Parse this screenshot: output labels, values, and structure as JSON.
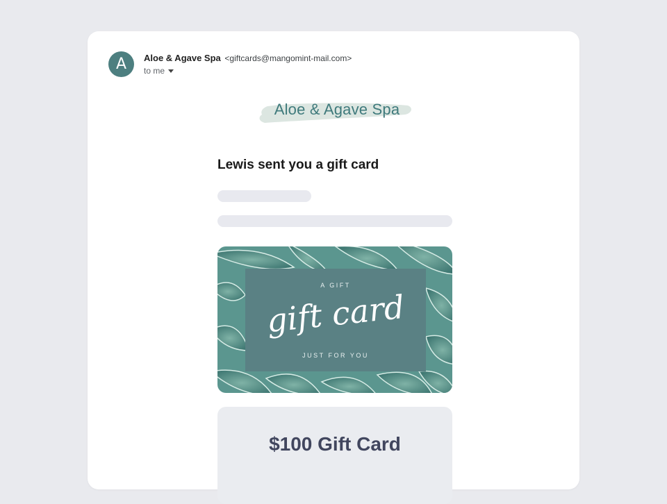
{
  "email": {
    "avatar_letter": "A",
    "sender_name": "Aloe & Agave Spa",
    "sender_email": "<giftcards@mangomint-mail.com>",
    "recipient": "to me"
  },
  "logo": {
    "text": "Aloe & Agave Spa",
    "brush_color": "#dce6e1",
    "text_color": "#3f7a7c"
  },
  "message": {
    "headline": "Lewis sent you a gift card"
  },
  "gift_card": {
    "top_text": "A GIFT",
    "script_text": "gift card",
    "bottom_text": "JUST FOR YOU",
    "panel_color": "#5a8184"
  },
  "amount": {
    "label": "$100 Gift Card"
  },
  "colors": {
    "background": "#e9eaee",
    "card": "#ffffff",
    "avatar": "#4d7f80",
    "skeleton": "#e8e9ef"
  }
}
